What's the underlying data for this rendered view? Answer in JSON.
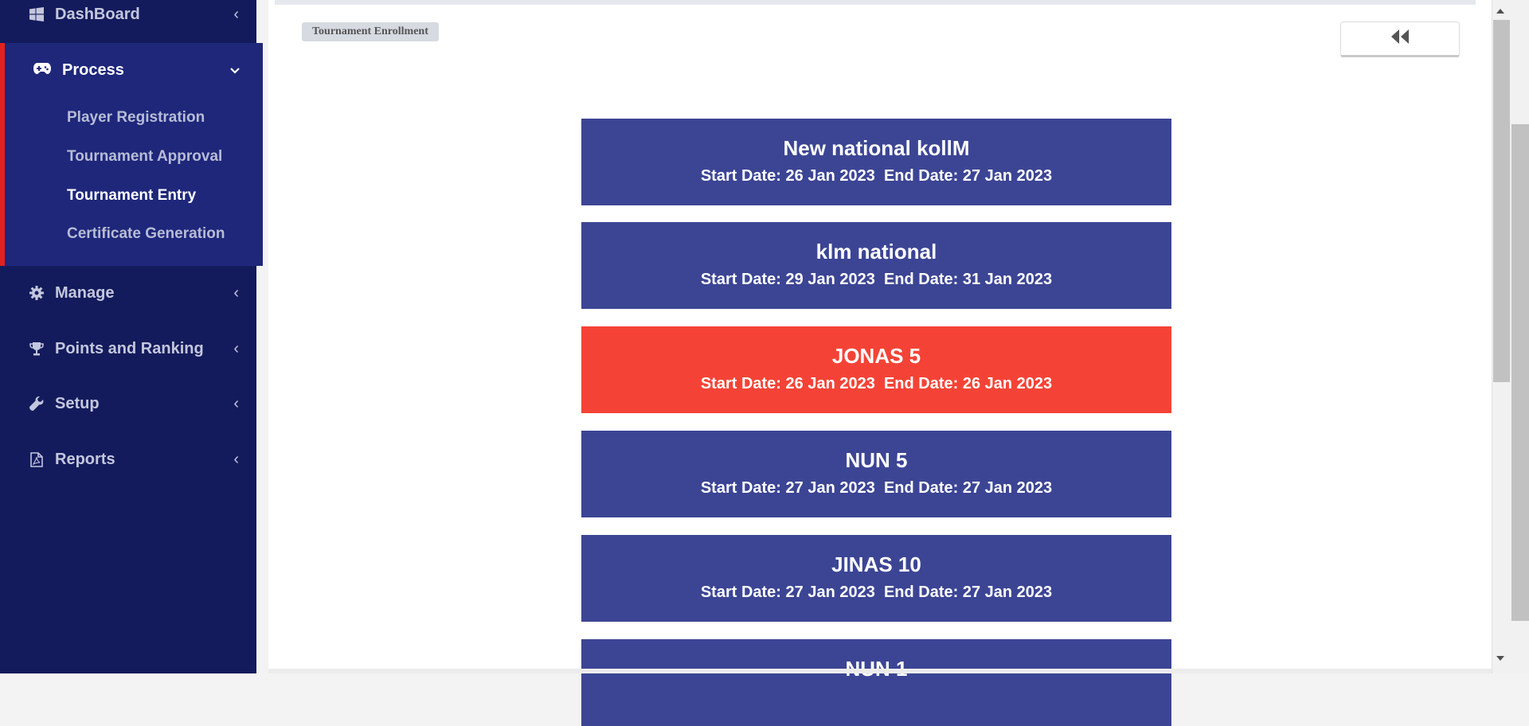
{
  "sidebar": {
    "dashboard": {
      "label": "DashBoard",
      "icon": "windows-icon"
    },
    "process": {
      "label": "Process",
      "icon": "gamepad-icon",
      "items": [
        {
          "label": "Player Registration",
          "active": false
        },
        {
          "label": "Tournament Approval",
          "active": false
        },
        {
          "label": "Tournament Entry",
          "active": true
        },
        {
          "label": "Certificate Generation",
          "active": false
        }
      ]
    },
    "manage": {
      "label": "Manage",
      "icon": "gear-icon"
    },
    "points": {
      "label": "Points and Ranking",
      "icon": "trophy-icon"
    },
    "setup": {
      "label": "Setup",
      "icon": "wrench-icon"
    },
    "reports": {
      "label": "Reports",
      "icon": "pdf-file-icon"
    }
  },
  "main": {
    "breadcrumb": "Tournament Enrollment",
    "back_icon": "double-chevron-left-icon",
    "tournaments": [
      {
        "name": "New national kollM",
        "dates": "Start Date: 26 Jan 2023  End Date: 27 Jan 2023",
        "color": "#3c4594"
      },
      {
        "name": "klm national",
        "dates": "Start Date: 29 Jan 2023  End Date: 31 Jan 2023",
        "color": "#3c4594"
      },
      {
        "name": "JONAS 5",
        "dates": "Start Date: 26 Jan 2023  End Date: 26 Jan 2023",
        "color": "#f44336"
      },
      {
        "name": "NUN 5",
        "dates": "Start Date: 27 Jan 2023  End Date: 27 Jan 2023",
        "color": "#3c4594"
      },
      {
        "name": "JINAS 10",
        "dates": "Start Date: 27 Jan 2023  End Date: 27 Jan 2023",
        "color": "#3c4594"
      },
      {
        "name": "NUN 1",
        "dates": "",
        "color": "#3c4594"
      }
    ]
  },
  "colors": {
    "sidebar_bg": "#141b5c",
    "process_bg": "#1e277a",
    "accent_red": "#e3211c",
    "card_blue": "#3c4594",
    "card_red": "#f44336"
  }
}
